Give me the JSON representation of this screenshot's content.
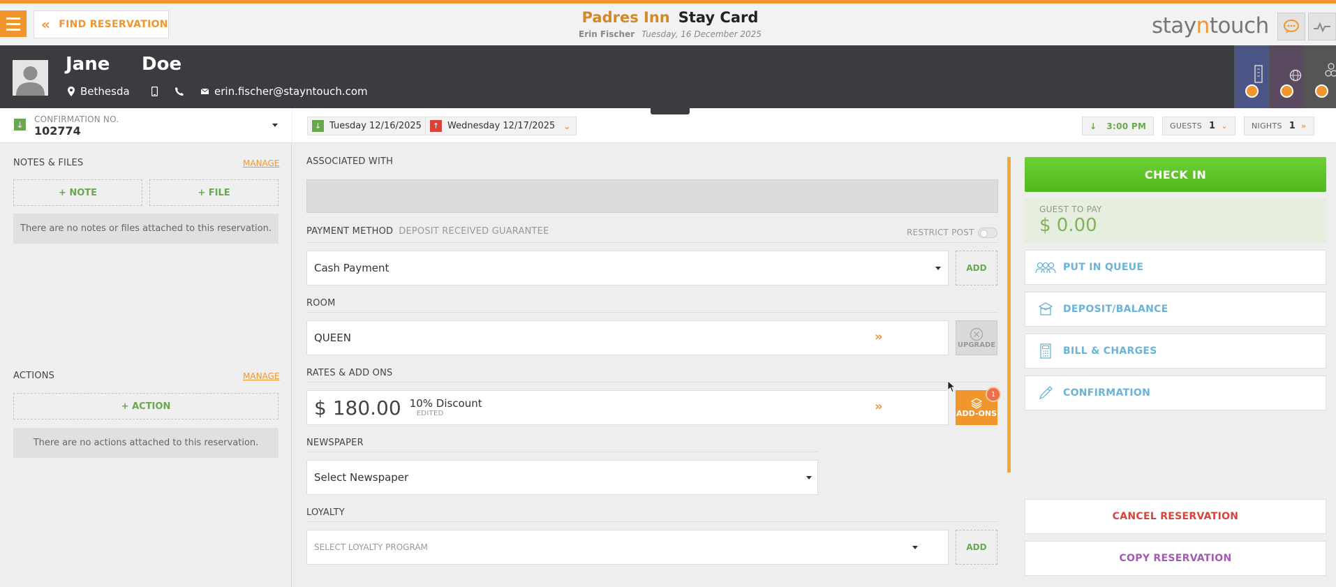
{
  "header": {
    "find_label": "FIND RESERVATION",
    "hotel": "Padres Inn",
    "page": "Stay Card",
    "user": "Erin Fischer",
    "date": "Tuesday, 16 December 2025",
    "brand_a": "stay",
    "brand_b": "n",
    "brand_c": "touch"
  },
  "guest": {
    "first_name": "Jane",
    "last_name": "Doe",
    "city": "Bethesda",
    "email": "erin.fischer@stayntouch.com"
  },
  "confirmation": {
    "label": "CONFIRMATION NO.",
    "number": "102774"
  },
  "notes": {
    "title": "NOTES & FILES",
    "manage": "MANAGE",
    "add_note": "+ NOTE",
    "add_file": "+ FILE",
    "empty": "There are no notes or files attached to this reservation."
  },
  "actions": {
    "title": "ACTIONS",
    "manage": "MANAGE",
    "add_action": "+ ACTION",
    "empty": "There are no actions attached to this reservation."
  },
  "stay": {
    "arrival": "Tuesday 12/16/2025",
    "departure": "Wednesday 12/17/2025",
    "time": "3:00 PM",
    "guests_label": "GUESTS",
    "guests": "1",
    "nights_label": "NIGHTS",
    "nights": "1"
  },
  "main": {
    "associated_with": "ASSOCIATED WITH",
    "payment_method": "PAYMENT METHOD",
    "payment_sub": "DEPOSIT RECEIVED GUARANTEE",
    "restrict_post": "RESTRICT POST",
    "payment_value": "Cash Payment",
    "add": "ADD",
    "room_label": "ROOM",
    "room_value": "QUEEN",
    "upgrade": "UPGRADE",
    "rates_label": "RATES & ADD ONS",
    "rate_price": "$ 180.00",
    "rate_name": "10% Discount",
    "rate_status": "EDITED",
    "addons": "ADD-ONS",
    "addons_count": "1",
    "newspaper_label": "NEWSPAPER",
    "newspaper_value": "Select Newspaper",
    "loyalty_label": "LOYALTY",
    "loyalty_value": "SELECT LOYALTY PROGRAM"
  },
  "right": {
    "check_in": "CHECK IN",
    "guest_to_pay_label": "GUEST TO PAY",
    "guest_to_pay_value": "$ 0.00",
    "put_in_queue": "PUT IN QUEUE",
    "deposit_balance": "DEPOSIT/BALANCE",
    "bill_charges": "BILL & CHARGES",
    "confirmation": "CONFIRMATION",
    "cancel": "CANCEL RESERVATION",
    "copy": "COPY RESERVATION"
  },
  "colors": {
    "accent": "#f0962d",
    "dark_band": "#3b3c40",
    "green": "#52b81f",
    "link_blue": "#6ab4d8",
    "cancel_red": "#d9433a",
    "copy_purple": "#a45ab5"
  },
  "icons": {
    "menu": "hamburger-icon",
    "back": "double-chevron-left-icon",
    "chat": "chat-icon",
    "pulse": "pulse-icon",
    "location": "map-pin-icon",
    "mobile": "mobile-phone-icon",
    "phone": "phone-icon",
    "email": "envelope-icon"
  }
}
